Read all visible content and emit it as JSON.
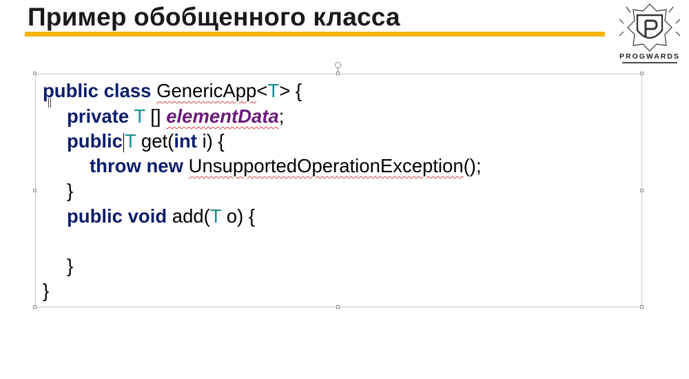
{
  "slide": {
    "title": "Пример обобщенного класса",
    "accent_color": "#f4b400"
  },
  "logo": {
    "text": "PROGWARDS",
    "icon": "shield-p-icon"
  },
  "code": {
    "lines": [
      {
        "tokens": [
          {
            "t": "public",
            "c": "kw"
          },
          {
            "t": " "
          },
          {
            "t": "class",
            "c": "kw"
          },
          {
            "t": " "
          },
          {
            "t": "GenericApp",
            "c": "squig"
          },
          {
            "t": "<"
          },
          {
            "t": "T",
            "c": "tp"
          },
          {
            "t": "> {"
          }
        ]
      },
      {
        "tokens": [
          {
            "t": "private",
            "c": "kw"
          },
          {
            "t": " "
          },
          {
            "t": "T",
            "c": "tp"
          },
          {
            "t": " [] "
          },
          {
            "t": "elementData",
            "c": "fld squig"
          },
          {
            "t": ";"
          }
        ]
      },
      {
        "tokens": [
          {
            "t": "public",
            "c": "kw"
          },
          {
            "t": "",
            "c": "caret"
          },
          {
            "t": "T",
            "c": "tp"
          },
          {
            "t": " get("
          },
          {
            "t": "int",
            "c": "kw"
          },
          {
            "t": " i) {"
          }
        ]
      },
      {
        "tokens": [
          {
            "t": "throw",
            "c": "kw"
          },
          {
            "t": " "
          },
          {
            "t": "new",
            "c": "kw"
          },
          {
            "t": " "
          },
          {
            "t": "UnsupportedOperationException",
            "c": "squig"
          },
          {
            "t": "();"
          }
        ]
      },
      {
        "tokens": [
          {
            "t": "}"
          }
        ]
      },
      {
        "tokens": [
          {
            "t": "public",
            "c": "kw"
          },
          {
            "t": " "
          },
          {
            "t": "void",
            "c": "kw"
          },
          {
            "t": " add("
          },
          {
            "t": "T",
            "c": "tp"
          },
          {
            "t": " o) {"
          }
        ]
      },
      {
        "tokens": [
          {
            "t": ""
          }
        ]
      },
      {
        "tokens": [
          {
            "t": "}"
          }
        ]
      },
      {
        "tokens": [
          {
            "t": "}"
          }
        ]
      }
    ]
  }
}
